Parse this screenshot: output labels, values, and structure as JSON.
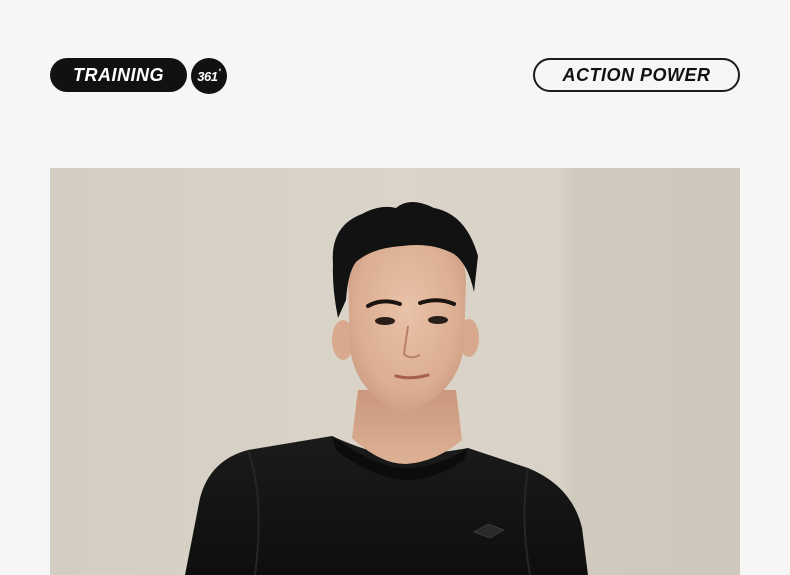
{
  "header": {
    "training_label": "TRAINING",
    "logo_text": "361",
    "logo_degree": "°",
    "action_label": "ACTION POWER"
  },
  "photo": {
    "background_color": "#d6d0c5",
    "shirt_color": "#141414",
    "skin_color": "#e2b79c",
    "hair_color": "#121212"
  }
}
